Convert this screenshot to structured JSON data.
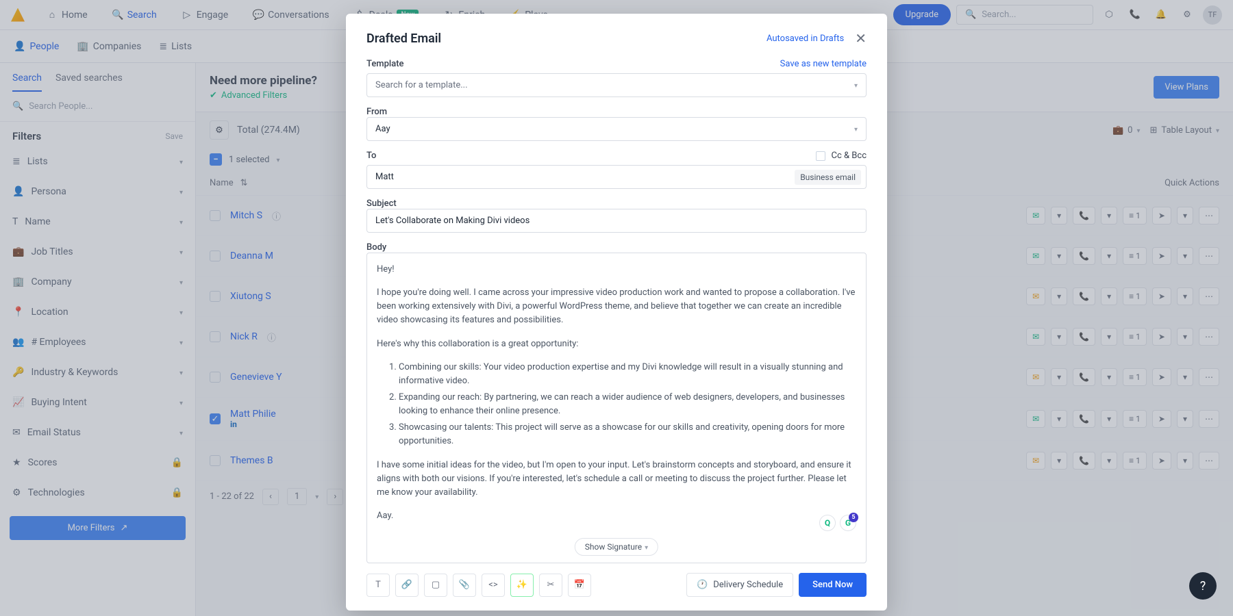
{
  "topnav": {
    "items": [
      "Home",
      "Search",
      "Engage",
      "Conversations",
      "Deals",
      "Enrich",
      "Plays"
    ],
    "deals_badge": "New",
    "upgrade": "Upgrade",
    "search_placeholder": "Search...",
    "avatar": "TF"
  },
  "subnav": {
    "items": [
      "People",
      "Companies",
      "Lists"
    ]
  },
  "sidebar": {
    "tabs": [
      "Search",
      "Saved searches"
    ],
    "search_placeholder": "Search People...",
    "filters_title": "Filters",
    "save": "Save",
    "filters": [
      "Lists",
      "Persona",
      "Name",
      "Job Titles",
      "Company",
      "Location",
      "# Employees",
      "Industry & Keywords",
      "Buying Intent",
      "Email Status",
      "Scores",
      "Technologies"
    ],
    "more": "More Filters"
  },
  "banner": {
    "title": "Need more pipeline?",
    "sub": "Advanced Filters",
    "cta": "View Plans"
  },
  "toolbar": {
    "total": "Total (274.4M)",
    "briefcase_count": "0",
    "layout": "Table Layout"
  },
  "selection": {
    "count": "1 selected"
  },
  "thead": {
    "name": "Name",
    "actions": "Quick Actions"
  },
  "rows": [
    {
      "name": "Mitch S",
      "checked": false,
      "info": true,
      "seq": "1",
      "variant": "green"
    },
    {
      "name": "Deanna M",
      "checked": false,
      "info": false,
      "seq": "1",
      "variant": "green"
    },
    {
      "name": "Xiutong S",
      "checked": false,
      "info": false,
      "seq": "1",
      "variant": "orange"
    },
    {
      "name": "Nick R",
      "checked": false,
      "info": true,
      "seq": "1",
      "variant": "green"
    },
    {
      "name": "Genevieve Y",
      "checked": false,
      "info": false,
      "seq": "1",
      "variant": "orange"
    },
    {
      "name": "Matt Philie",
      "checked": true,
      "info": false,
      "seq": "1",
      "variant": "green",
      "linkedin": "in"
    },
    {
      "name": "Themes B",
      "checked": false,
      "info": false,
      "seq": "1",
      "variant": "orange"
    }
  ],
  "pager": {
    "range": "1 - 22 of 22",
    "page": "1"
  },
  "modal": {
    "title": "Drafted Email",
    "autosave": "Autosaved in Drafts",
    "template_label": "Template",
    "template_link": "Save as new template",
    "template_placeholder": "Search for a template...",
    "from_label": "From",
    "from_value": "Aay",
    "to_label": "To",
    "to_value": "Matt",
    "cc_label": "Cc & Bcc",
    "biz_badge": "Business email",
    "subject_label": "Subject",
    "subject_value": "Let's Collaborate on Making Divi videos",
    "body_label": "Body",
    "body": {
      "greeting": "Hey!",
      "intro": "I hope you're doing well. I came across your impressive video production work and wanted to propose a collaboration. I've been working extensively with Divi, a powerful WordPress theme, and believe that together we can create an incredible video showcasing its features and possibilities.",
      "why": "Here's why this collaboration is a great opportunity:",
      "points": [
        "Combining our skills: Your video production expertise and my Divi knowledge will result in a visually stunning and informative video.",
        "Expanding our reach: By partnering, we can reach a wider audience of web designers, developers, and businesses looking to enhance their online presence.",
        "Showcasing our talents: This project will serve as a showcase for our skills and creativity, opening doors for more opportunities."
      ],
      "closing": "I have some initial ideas for the video, but I'm open to your input. Let's brainstorm concepts and storyboard, and ensure it aligns with both our visions. If you're interested, let's schedule a call or meeting to discuss the project further. Please let me know your availability.",
      "sign": "Aay."
    },
    "assist_count": "5",
    "show_sig": "Show Signature",
    "delivery": "Delivery Schedule",
    "send": "Send Now"
  }
}
